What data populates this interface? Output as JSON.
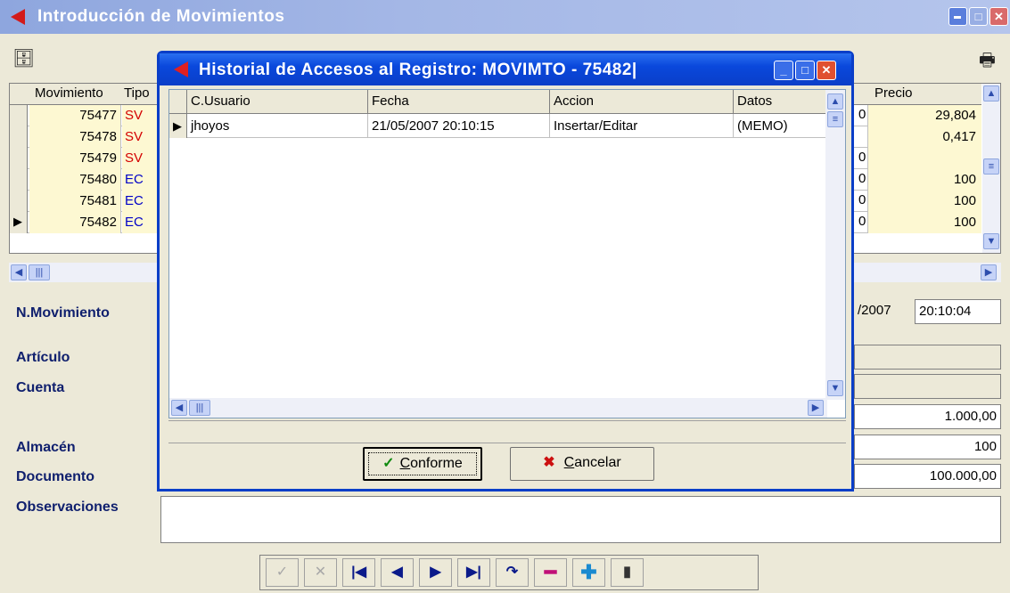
{
  "main_window": {
    "title": "Introducción de Movimientos",
    "grid": {
      "headers": {
        "movimiento": "Movimiento",
        "tipo": "Tipo",
        "precio": "Precio"
      },
      "rows": [
        {
          "movimiento": "75477",
          "tipo": "SV",
          "precio": "29,804",
          "frag": ""
        },
        {
          "movimiento": "75478",
          "tipo": "SV",
          "precio": "0,417",
          "frag": ""
        },
        {
          "movimiento": "75479",
          "tipo": "SV",
          "precio": "",
          "frag": "0"
        },
        {
          "movimiento": "75480",
          "tipo": "EC",
          "precio": "100",
          "frag": "0"
        },
        {
          "movimiento": "75481",
          "tipo": "EC",
          "precio": "100",
          "frag": "0"
        },
        {
          "movimiento": "75482",
          "tipo": "EC",
          "precio": "100",
          "frag": "0"
        }
      ],
      "first_row_frag": "0"
    },
    "labels": {
      "n_movimiento": "N.Movimiento",
      "articulo": "Artículo",
      "cuenta": "Cuenta",
      "almacen": "Almacén",
      "documento": "Documento",
      "observaciones": "Observaciones"
    },
    "fields": {
      "date_fragment": "/2007",
      "time": "20:10:04",
      "cantidad": "1.000,00",
      "precio": "100",
      "importe": "100.000,00"
    }
  },
  "dialog": {
    "title": "Historial de Accesos al Registro: MOVIMTO - 75482|",
    "columns": [
      "C.Usuario",
      "Fecha",
      "Accion",
      "Datos"
    ],
    "rows": [
      {
        "usuario": "jhoyos",
        "fecha": "21/05/2007 20:10:15",
        "accion": "Insertar/Editar",
        "datos": "(MEMO)"
      }
    ],
    "buttons": {
      "ok_accel": "C",
      "ok_rest": "onforme",
      "cancel_accel": "C",
      "cancel_rest": "ancelar"
    }
  },
  "icons": {
    "row_pointer": "row-pointer-icon",
    "print": "print-icon",
    "tool": "toolbar-icon"
  },
  "colors": {
    "dialog_title": "#0a3ec8",
    "main_title": "#a4b7e6",
    "grid_cell": "#fdf8d2"
  }
}
